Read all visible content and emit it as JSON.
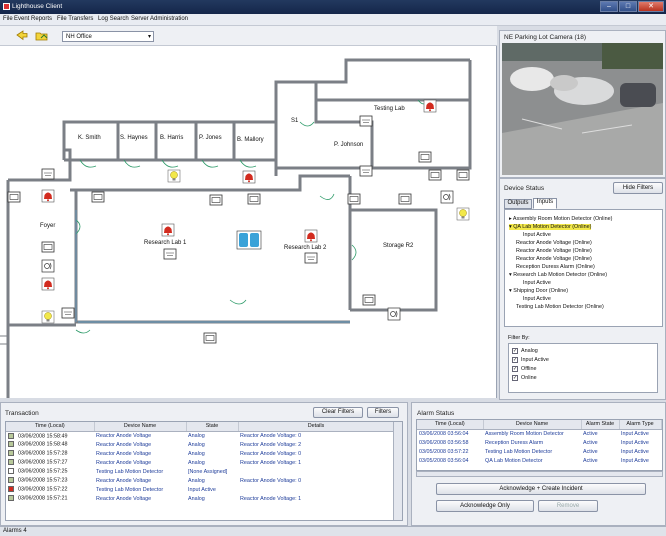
{
  "window": {
    "title": "Lighthouse Client",
    "min_label": "–",
    "max_label": "□",
    "close_label": "✕"
  },
  "menu": {
    "items": [
      "File",
      "Event Reports",
      "File Transfers",
      "Log Search",
      "Server Administration"
    ]
  },
  "toolbar": {
    "site_select": "NH Office"
  },
  "map": {
    "rooms": {
      "smith": "K. Smith",
      "haynes": "S. Haynes",
      "harris": "B. Harris",
      "jones": "P. Jones",
      "mallory": "B. Mallory",
      "s1": "S1",
      "testing_lab": "Testing Lab",
      "johnson": "P. Johnson",
      "foyer": "Foyer",
      "research1": "Research Lab 1",
      "research2": "Research Lab 2",
      "storage": "Storage R2"
    }
  },
  "camera": {
    "title": "NE Parking Lot Camera (18)"
  },
  "device_status": {
    "title": "Device Status",
    "hide_filters": "Hide Filters",
    "tabs": [
      "Outputs",
      "Inputs"
    ],
    "tree": [
      "Assembly Room Motion Detector (Online)",
      "QA Lab Motion Detector (Online)",
      "Input Active",
      "Reactor Anode Voltage (Online)",
      "Reactor Anode Voltage (Online)",
      "Reactor Anode Voltage (Online)",
      "Reception Duress Alarm (Online)",
      "Research Lab Motion Detector (Online)",
      "Input Active",
      "Shipping Door (Online)",
      "Input Active",
      "Testing Lab Motion Detector (Online)"
    ],
    "filter_by": "Filter By:",
    "filters": [
      "Analog",
      "Input Active",
      "Offline",
      "Online"
    ]
  },
  "transaction": {
    "title": "Transaction",
    "clear_filters": "Clear Filters",
    "filters": "Filters",
    "columns": [
      "Time (Local)",
      "Device Name",
      "State",
      "Details"
    ],
    "rows": [
      [
        "03/06/2008 15:58:49",
        "Reactor Anode Voltage",
        "Analog",
        "Reactor Anode Voltage: 0"
      ],
      [
        "03/06/2008 15:58:48",
        "Reactor Anode Voltage",
        "Analog",
        "Reactor Anode Voltage: 2"
      ],
      [
        "03/06/2008 15:57:28",
        "Reactor Anode Voltage",
        "Analog",
        "Reactor Anode Voltage: 0"
      ],
      [
        "03/06/2008 15:57:27",
        "Reactor Anode Voltage",
        "Analog",
        "Reactor Anode Voltage: 1"
      ],
      [
        "03/06/2008 15:57:25",
        "Testing Lab Motion Detector",
        "[None Assigned]",
        ""
      ],
      [
        "03/06/2008 15:57:23",
        "Reactor Anode Voltage",
        "Analog",
        "Reactor Anode Voltage: 0"
      ],
      [
        "03/06/2008 15:57:22",
        "Testing Lab Motion Detector",
        "Input Active",
        ""
      ],
      [
        "03/06/2008 15:57:21",
        "Reactor Anode Voltage",
        "Analog",
        "Reactor Anode Voltage: 1"
      ]
    ],
    "row_colors": [
      "#b8c99a",
      "#b8c99a",
      "#b8c99a",
      "#b8c99a",
      "#ffffff",
      "#b8c99a",
      "#d22b1f",
      "#b8c99a"
    ]
  },
  "alarm_status": {
    "title": "Alarm Status",
    "columns": [
      "Time (Local)",
      "Device Name",
      "Alarm State",
      "Alarm Type"
    ],
    "rows": [
      [
        "03/06/2008 03:56:04",
        "Assembly Room Motion Detector",
        "Active",
        "Input Active"
      ],
      [
        "03/06/2008 03:56:58",
        "Reception Duress Alarm",
        "Active",
        "Input Active"
      ],
      [
        "03/05/2008 03:57:22",
        "Testing Lab Motion Detector",
        "Active",
        "Input Active"
      ],
      [
        "03/05/2008 03:56:04",
        "QA Lab Motion Detector",
        "Active",
        "Input Active"
      ]
    ],
    "ack_incident": "Acknowledge + Create Incident",
    "ack_only": "Acknowledge Only",
    "remove": "Remove"
  },
  "statusbar": {
    "tab": "Alarms",
    "count": "4"
  },
  "colors": {
    "accent": "#15264a",
    "alarm_red": "#d22b1f",
    "highlight": "#f2e84a"
  }
}
